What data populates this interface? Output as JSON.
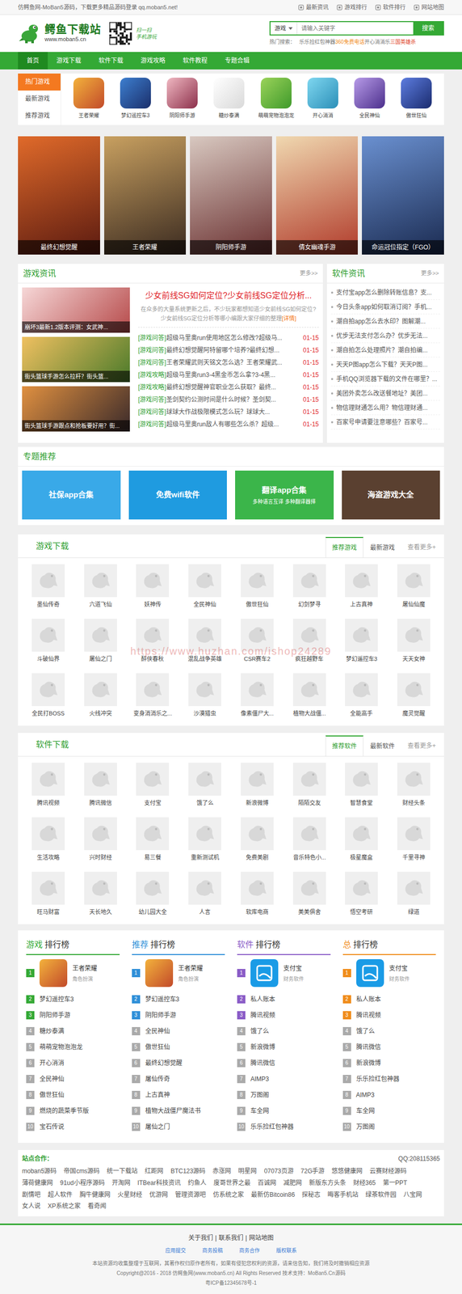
{
  "top_bar": {
    "notice": "仿鳄鱼网-MoBan5源码，下载更多精品源码登录 qq.moban5.net!",
    "links": [
      "最新资讯",
      "游戏排行",
      "软件排行",
      "网站地图"
    ]
  },
  "header": {
    "logo_title": "鳄鱼下载站",
    "logo_url": "www.moban5.cn",
    "qr_caption": [
      "扫一扫",
      "手机游玩"
    ],
    "search": {
      "category": "游戏",
      "placeholder": "请输入关键字",
      "button": "搜索"
    },
    "hot_label": "热门搜索：",
    "hot_words": [
      {
        "text": "乐乐捡红包神器",
        "color": "#777777"
      },
      {
        "text": "360免费电话",
        "color": "#f08c1a"
      },
      {
        "text": "开心消消乐",
        "color": "#777777"
      },
      {
        "text": "三国英雄杀",
        "color": "#e0462b"
      }
    ]
  },
  "nav": {
    "items": [
      {
        "label": "首页",
        "selected": true
      },
      {
        "label": "游戏下载",
        "selected": false
      },
      {
        "label": "软件下载",
        "selected": false
      },
      {
        "label": "游戏攻略",
        "selected": false
      },
      {
        "label": "软件教程",
        "selected": false
      },
      {
        "label": "专题合辑",
        "selected": false
      }
    ]
  },
  "hot_games": {
    "tabs": [
      {
        "label": "热门游戏",
        "selected": true
      },
      {
        "label": "最新游戏",
        "selected": false
      },
      {
        "label": "推荐游戏",
        "selected": false
      }
    ],
    "games": [
      "王者荣耀",
      "梦幻遥控车3",
      "阴阳师手游",
      "糖炒泰满",
      "萌萌宠物泡泡龙",
      "开心消消",
      "全民神仙",
      "傲世狂仙"
    ]
  },
  "banners": {
    "items": [
      "最终幻想觉醒",
      "王者荣耀",
      "阴阳师手游",
      "倩女幽魂手游",
      "命运冠位指定（FGO）"
    ]
  },
  "game_news": {
    "title": "游戏资讯",
    "more": "更多>>",
    "thumbs": [
      "崩坏3最新1.2版本评测：女武神...",
      "街头篮球手游怎么拉杆？街头篮...",
      "街头篮球手游跟点和抢板要好用？街..."
    ],
    "headline": "少女前线SG如何定位?少女前线SG定位分析...",
    "summary": "在众多的大量系统更新之后，不少玩家都想知道少女前线SG如何定位? 少女前线SG定位分析等哪小编跟大家仔细的整理",
    "detail": "[详情]",
    "items": [
      {
        "category": "[游戏问答]",
        "title": "超级马里奥run使用地区怎么修改?超级马...",
        "date": "01-15"
      },
      {
        "category": "[游戏问答]",
        "title": "最终幻想觉醒阿特留哪个培养?最终幻想...",
        "date": "01-15"
      },
      {
        "category": "[游戏问答]",
        "title": "王者荣耀武则天铭文怎么选？王者荣耀武...",
        "date": "01-15"
      },
      {
        "category": "[游戏攻略]",
        "title": "超级马里奥run3-4黑金币怎么拿?3-4黑...",
        "date": "01-15"
      },
      {
        "category": "[游戏攻略]",
        "title": "最终幻想觉醒神官职业怎么获取？最终...",
        "date": "01-15"
      },
      {
        "category": "[游戏问答]",
        "title": "圣剑契约公测时间是什么时候？圣剑契...",
        "date": "01-15"
      },
      {
        "category": "[游戏问答]",
        "title": "球球大作战极限模式怎么玩？球球大...",
        "date": "01-15"
      },
      {
        "category": "[游戏问答]",
        "title": "超级马里奥run敌人有哪些怎么杀？超级...",
        "date": "01-15"
      }
    ]
  },
  "software_news": {
    "title": "软件资讯",
    "more": "更多>>",
    "items": [
      "支付宝app怎么删除转账信息？支...",
      "今日头条app如何取消订阅？手机...",
      "潮自拍app怎么去水印？图解潮...",
      "优步无法支付怎么办？优步无法...",
      "潮自拍怎么处理照片？潮自拍编...",
      "天天P图app怎么下载？天天P图...",
      "手机QQ浏览器下载的文件在哪里？...",
      "美团外卖怎么改送餐地址？美团...",
      "物信理财通怎么用？物信理财通...",
      "百家号申请要注意哪些？百家号..."
    ]
  },
  "topics": {
    "title": "专题推荐",
    "items": [
      {
        "title": "社保app合集",
        "subtitle": ""
      },
      {
        "title": "免费wifi软件",
        "subtitle": ""
      },
      {
        "title": "翻译app合集",
        "subtitle": "多种语言互译 多种翻译器择"
      },
      {
        "title": "海盗游戏大全",
        "subtitle": ""
      }
    ]
  },
  "game_downloads": {
    "title": "游戏下载",
    "tabs": [
      {
        "label": "推荐游戏",
        "selected": true
      },
      {
        "label": "最新游戏",
        "selected": false
      }
    ],
    "more": "查看更多+",
    "items": [
      "墨仙传奇",
      "六道飞仙",
      "妖神传",
      "全民神仙",
      "傲世狂仙",
      "幻剑梦寻",
      "上古真神",
      "屠仙仙魔",
      "斗破仙界",
      "屠仙之门",
      "醉侠春秋",
      "混乱战争英雄",
      "CSR赛车2",
      "疯狂越野车",
      "梦幻遥控车3",
      "天天女神",
      "全民打BOSS",
      "火线冲突",
      "变身消消乐之...",
      "沙漠猎虫",
      "像素僵尸大...",
      "植物大战僵...",
      "全能高手",
      "魔灵觉醒"
    ]
  },
  "software_downloads": {
    "title": "软件下载",
    "tabs": [
      {
        "label": "推荐软件",
        "selected": true
      },
      {
        "label": "最新软件",
        "selected": false
      }
    ],
    "more": "查看更多+",
    "items": [
      "腾讯视频",
      "腾讯微信",
      "支付宝",
      "饿了么",
      "新浪微博",
      "陌陌交友",
      "智慧食堂",
      "财经头条",
      "生活攻略",
      "兴时财经",
      "易三餐",
      "重新测试机",
      "免费美剧",
      "音乐特色小...",
      "极星魔盒",
      "千里寻神",
      "旺马财富",
      "天长地久",
      "幼儿园大全",
      "人言",
      "软库电商",
      "美美俱舍",
      "悟空考研",
      "绿道"
    ]
  },
  "watermark": "https://www.huzhan.com/ishop24289",
  "rankings": {
    "columns": [
      {
        "prefix": "游戏",
        "suffix": "排行榜",
        "color": "#34a935",
        "kind": "game",
        "top": {
          "rank": "1",
          "name": "王者荣耀",
          "category": "角色扮演",
          "highlight": true
        },
        "items": [
          {
            "rank": "2",
            "name": "梦幻遥控车3",
            "highlight": true
          },
          {
            "rank": "3",
            "name": "阴阳师手游",
            "highlight": true
          },
          {
            "rank": "4",
            "name": "糖炒泰满",
            "highlight": false
          },
          {
            "rank": "5",
            "name": "萌萌宠物泡泡龙",
            "highlight": false
          },
          {
            "rank": "6",
            "name": "开心消消",
            "highlight": false
          },
          {
            "rank": "7",
            "name": "全民神仙",
            "highlight": false
          },
          {
            "rank": "8",
            "name": "傲世狂仙",
            "highlight": false
          },
          {
            "rank": "9",
            "name": "燃烧的蔬菜季节版",
            "highlight": false
          },
          {
            "rank": "10",
            "name": "宝石传说",
            "highlight": false
          }
        ]
      },
      {
        "prefix": "推荐",
        "suffix": "排行榜",
        "color": "#2f8fd8",
        "kind": "game",
        "top": {
          "rank": "1",
          "name": "王者荣耀",
          "category": "角色扮演",
          "highlight": true
        },
        "items": [
          {
            "rank": "2",
            "name": "梦幻遥控车3",
            "highlight": true
          },
          {
            "rank": "3",
            "name": "阴阳师手游",
            "highlight": true
          },
          {
            "rank": "4",
            "name": "全民神仙",
            "highlight": false
          },
          {
            "rank": "5",
            "name": "傲世狂仙",
            "highlight": false
          },
          {
            "rank": "6",
            "name": "最终幻想觉醒",
            "highlight": false
          },
          {
            "rank": "7",
            "name": "屠仙传奇",
            "highlight": false
          },
          {
            "rank": "8",
            "name": "上古真神",
            "highlight": false
          },
          {
            "rank": "9",
            "name": "植物大战僵尸魔法书",
            "highlight": false
          },
          {
            "rank": "10",
            "name": "屠仙之门",
            "highlight": false
          }
        ]
      },
      {
        "prefix": "软件",
        "suffix": "排行榜",
        "color": "#8a5cc7",
        "kind": "app",
        "top": {
          "rank": "1",
          "name": "支付宝",
          "category": "财务软件",
          "highlight": true
        },
        "items": [
          {
            "rank": "2",
            "name": "私人账本",
            "highlight": true
          },
          {
            "rank": "3",
            "name": "腾讯视频",
            "highlight": true
          },
          {
            "rank": "4",
            "name": "饿了么",
            "highlight": false
          },
          {
            "rank": "5",
            "name": "新浪微博",
            "highlight": false
          },
          {
            "rank": "6",
            "name": "腾讯微信",
            "highlight": false
          },
          {
            "rank": "7",
            "name": "AIMP3",
            "highlight": false
          },
          {
            "rank": "8",
            "name": "万图阁",
            "highlight": false
          },
          {
            "rank": "9",
            "name": "车全网",
            "highlight": false
          },
          {
            "rank": "10",
            "name": "乐乐捡红包神器",
            "highlight": false
          }
        ]
      },
      {
        "prefix": "总",
        "suffix": "排行榜",
        "color": "#f08c1a",
        "kind": "app",
        "top": {
          "rank": "1",
          "name": "支付宝",
          "category": "财务软件",
          "highlight": true
        },
        "items": [
          {
            "rank": "2",
            "name": "私人账本",
            "highlight": true
          },
          {
            "rank": "3",
            "name": "腾讯视频",
            "highlight": true
          },
          {
            "rank": "4",
            "name": "饿了么",
            "highlight": false
          },
          {
            "rank": "5",
            "name": "腾讯微信",
            "highlight": false
          },
          {
            "rank": "6",
            "name": "新浪微博",
            "highlight": false
          },
          {
            "rank": "7",
            "name": "乐乐捡红包神器",
            "highlight": false
          },
          {
            "rank": "8",
            "name": "AIMP3",
            "highlight": false
          },
          {
            "rank": "9",
            "name": "车全网",
            "highlight": false
          },
          {
            "rank": "10",
            "name": "万图阁",
            "highlight": false
          }
        ]
      }
    ]
  },
  "partners": {
    "title": "站点合作：",
    "qq": "QQ:208115365",
    "links": [
      "moban5源码",
      "帝国cms源码",
      "统一下载站",
      "红距网",
      "BTC123源码",
      "赤涨网",
      "明星网",
      "07073页游",
      "72G手游",
      "悠悠健康网",
      "云赛财经源码",
      "薄荷健康网",
      "91ud小程序源码",
      "开淘网",
      "ITBear科技资讯",
      "约鱼人",
      "度哥世界之最",
      "百诚网",
      "减肥网",
      "新版东方头条",
      "财经365",
      "第一PPT",
      "剧情吧",
      "超人软件",
      "胸牛健康网",
      "火星财经",
      "优游网",
      "管理资源吧",
      "仿系统之家",
      "最新仿Bitcoin86",
      "探秘志",
      "晦客手机站",
      "绿茶软件园",
      "八宝网",
      "女人说",
      "XP系统之家",
      "看奇闻"
    ]
  },
  "footer": {
    "links": [
      "关于我们",
      "联系我们",
      "网站地图"
    ],
    "separator": "|",
    "sub_links": [
      "应用提交",
      "商务投稿",
      "商务合作",
      "版权联系"
    ],
    "lines": [
      "本站资源均收集整理于互联网，其著作权归原作者所有，如果有侵犯您权利的资源，请来信告知，我们将及时撤销相应资源",
      "Copyright@2016 - 2018 仿鳄鱼网(www.moban5.cn) All Rights Reserved 技术支持：MoBan5.Cn源码",
      "粤ICP备12345678号-1"
    ]
  }
}
